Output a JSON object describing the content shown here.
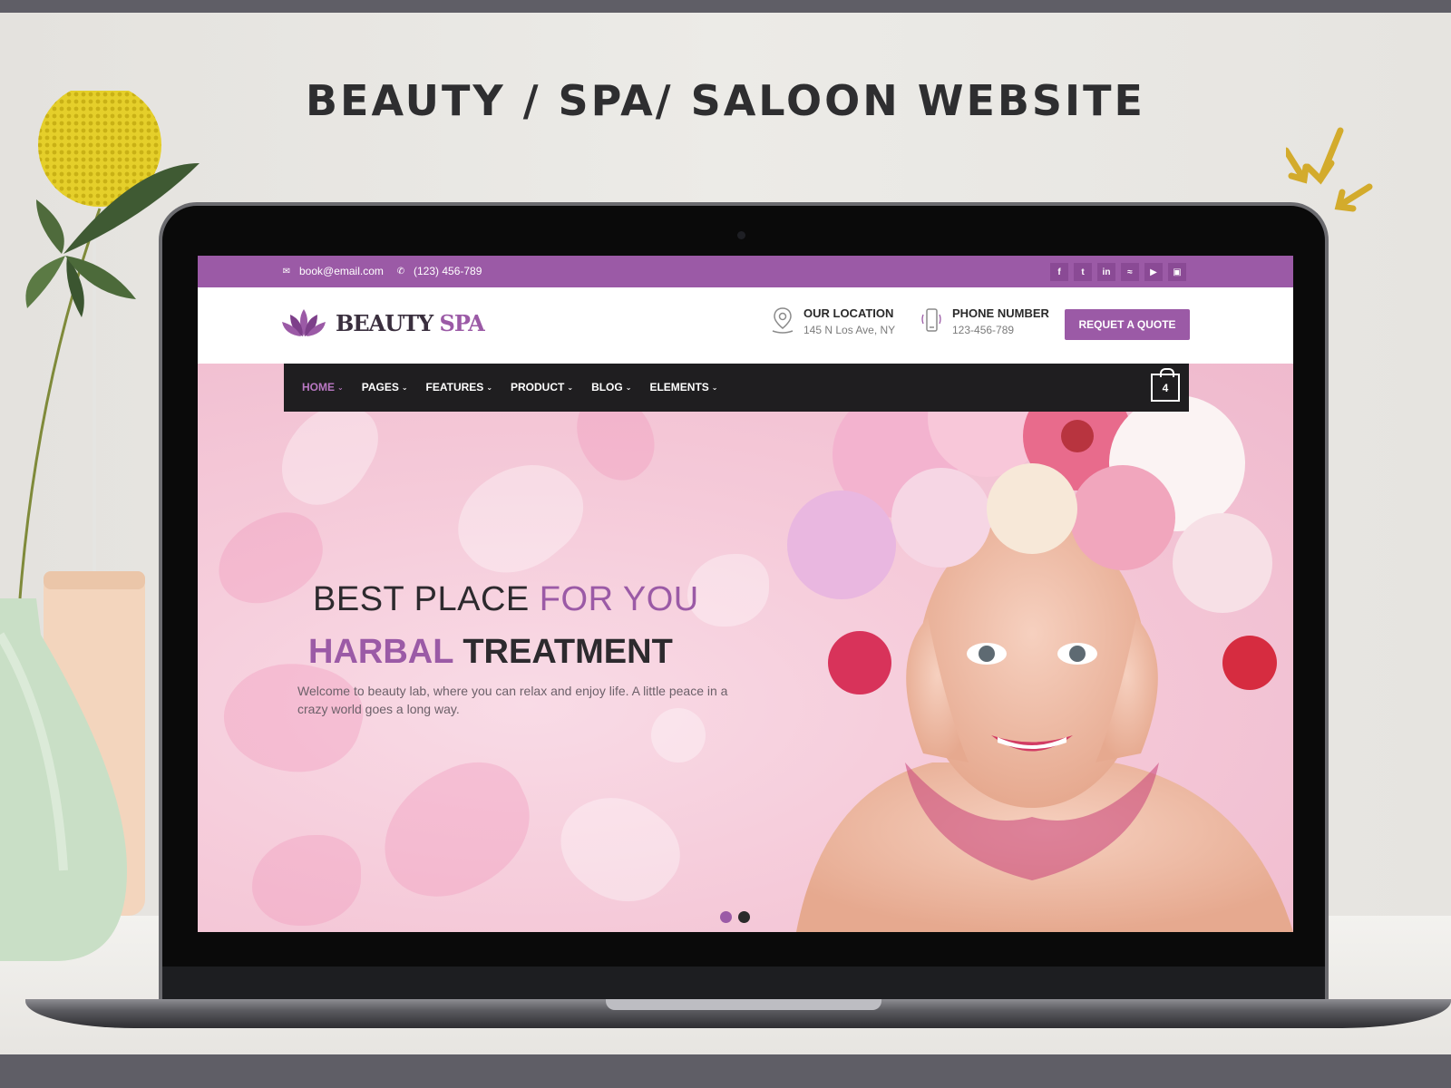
{
  "mockup_title": "BEAUTY / SPA/ SALOON WEBSITE",
  "site": {
    "topbar": {
      "email": "book@email.com",
      "phone": "(123) 456-789",
      "social_icons": [
        "facebook-icon",
        "twitter-icon",
        "linkedin-icon",
        "rss-icon",
        "youtube-icon",
        "instagram-icon"
      ]
    },
    "logo": {
      "word1": "BEAUTY",
      "word2": "SPA"
    },
    "location": {
      "title": "OUR LOCATION",
      "value": "145 N Los Ave, NY"
    },
    "phone_block": {
      "title": "PHONE NUMBER",
      "value": "123-456-789"
    },
    "quote_button": "REQUET A QUOTE",
    "nav": [
      {
        "label": "HOME",
        "active": true
      },
      {
        "label": "PAGES"
      },
      {
        "label": "FEATURES"
      },
      {
        "label": "PRODUCT"
      },
      {
        "label": "BLOG"
      },
      {
        "label": "ELEMENTS"
      }
    ],
    "cart_count": "4",
    "hero": {
      "line1_plain": "BEST PLACE",
      "line1_accent": "FOR YOU",
      "line2_accent": "HARBAL",
      "line2_plain": "TREATMENT",
      "description": "Welcome to beauty lab, where you can relax and enjoy life. A little peace in a crazy world goes a long way."
    },
    "slider_dots": 2,
    "active_dot": 1
  },
  "colors": {
    "accent": "#9b5aa6",
    "nav_bg": "#1f1e20",
    "hero_pink": "#f5cad9"
  }
}
